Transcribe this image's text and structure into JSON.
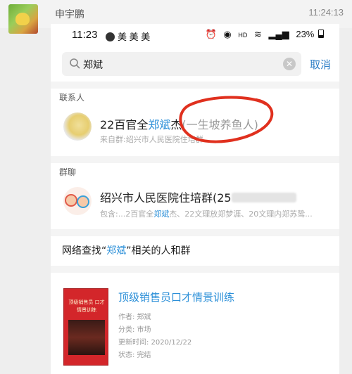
{
  "outer": {
    "sender": "申宇鹏",
    "time": "11:24:13"
  },
  "status_bar": {
    "time": "11:23",
    "apps": "美 美 美",
    "hd": "HD",
    "battery": "23%"
  },
  "search": {
    "query": "郑斌",
    "cancel_label": "取消"
  },
  "contacts": {
    "section_label": "联系人",
    "name_prefix": "22百官全",
    "name_highlight": "郑斌",
    "name_suffix": "杰",
    "name_muted": "(一生坡养鱼人)",
    "source": "来自群:绍兴市人民医院住培群"
  },
  "groups": {
    "section_label": "群聊",
    "name": "绍兴市人民医院住培群(25",
    "includes_prefix": "包含:...2百官全",
    "includes_highlight": "郑斌",
    "includes_suffix": "杰、22文理放郑梦涯、20文理内郑苏鸷..."
  },
  "web_search": {
    "prefix": "网络查找“",
    "highlight": "郑斌",
    "suffix": "”相关的人和群"
  },
  "book": {
    "title": "顶级销售员口才情景训练",
    "cover_title": "顶级销售员 口才情景训练",
    "author": "作者: 郑斌",
    "category": "分类: 市场",
    "updated": "更新时间: 2020/12/22",
    "status": "状态: 完结"
  },
  "colors": {
    "highlight": "#2b8fd8",
    "annotation": "#e0301e",
    "cover": "#d3262a"
  }
}
